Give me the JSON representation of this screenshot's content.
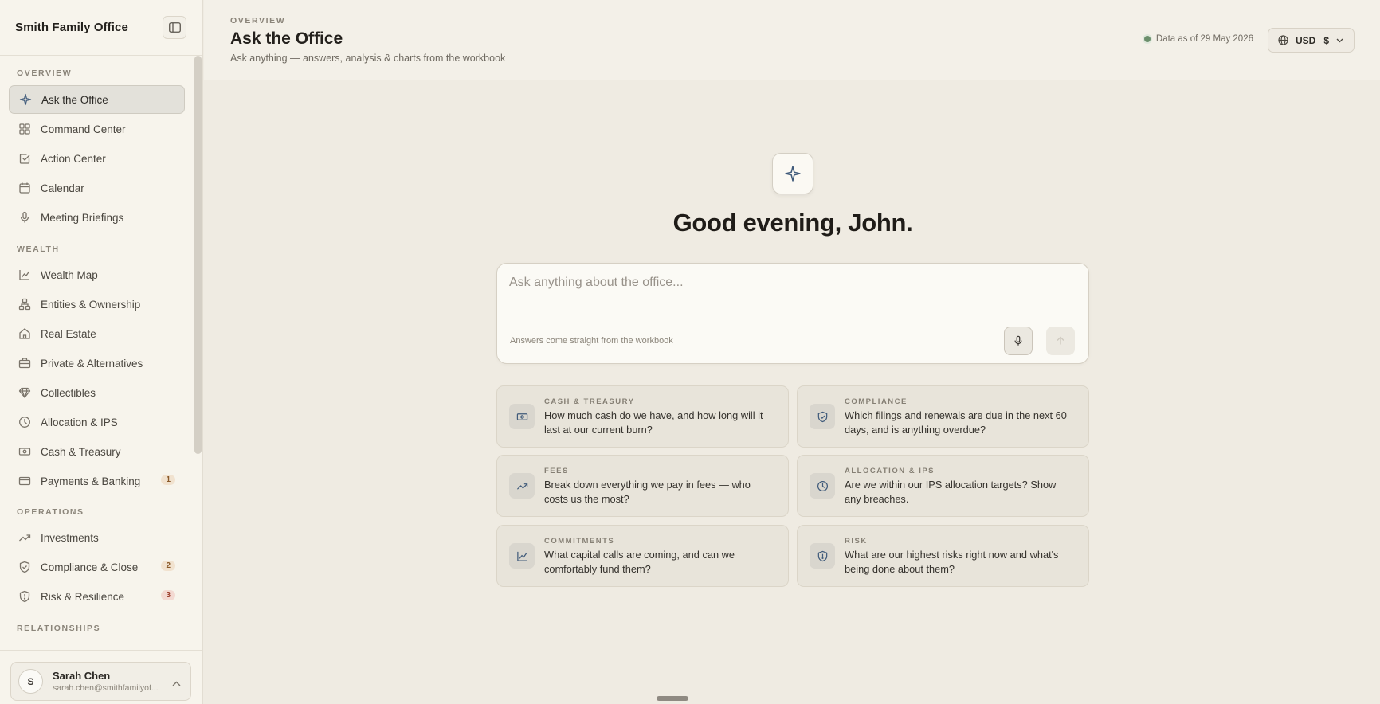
{
  "brand": "Smith Family Office",
  "sidebar": {
    "sections": [
      {
        "label": "OVERVIEW"
      },
      {
        "label": "WEALTH"
      },
      {
        "label": "OPERATIONS"
      },
      {
        "label": "RELATIONSHIPS"
      }
    ],
    "items": [
      {
        "label": "Ask the Office",
        "icon": "sparkle-icon",
        "active": true
      },
      {
        "label": "Command Center",
        "icon": "grid-icon"
      },
      {
        "label": "Action Center",
        "icon": "checkbox-icon"
      },
      {
        "label": "Calendar",
        "icon": "calendar-icon"
      },
      {
        "label": "Meeting Briefings",
        "icon": "mic-icon"
      },
      {
        "label": "Wealth Map",
        "icon": "line-chart-icon"
      },
      {
        "label": "Entities & Ownership",
        "icon": "org-chart-icon"
      },
      {
        "label": "Real Estate",
        "icon": "house-icon"
      },
      {
        "label": "Private & Alternatives",
        "icon": "briefcase-icon"
      },
      {
        "label": "Collectibles",
        "icon": "diamond-icon"
      },
      {
        "label": "Allocation & IPS",
        "icon": "clock-icon"
      },
      {
        "label": "Cash & Treasury",
        "icon": "banknote-icon"
      },
      {
        "label": "Payments & Banking",
        "icon": "card-icon",
        "badge": "1"
      },
      {
        "label": "Investments",
        "icon": "trend-up-icon"
      },
      {
        "label": "Compliance & Close",
        "icon": "shield-icon",
        "badge": "2"
      },
      {
        "label": "Risk & Resilience",
        "icon": "alert-shield-icon",
        "badge": "3"
      }
    ]
  },
  "user": {
    "initial": "S",
    "name": "Sarah Chen",
    "email": "sarah.chen@smithfamilyof..."
  },
  "header": {
    "crumb": "OVERVIEW",
    "title": "Ask the Office",
    "subtitle": "Ask anything — answers, analysis & charts from the workbook",
    "data_asof": "Data as of 29 May 2026",
    "currency": "USD",
    "currency_symbol": "$"
  },
  "main": {
    "greeting": "Good evening, John.",
    "ask_placeholder": "Ask anything about the office...",
    "ask_hint": "Answers come straight from the workbook"
  },
  "suggestions": [
    {
      "tag": "CASH & TREASURY",
      "text": "How much cash do we have, and how long will it last at our current burn?",
      "icon": "banknote-icon"
    },
    {
      "tag": "COMPLIANCE",
      "text": "Which filings and renewals are due in the next 60 days, and is anything overdue?",
      "icon": "shield-check-icon"
    },
    {
      "tag": "FEES",
      "text": "Break down everything we pay in fees — who costs us the most?",
      "icon": "trend-up-icon"
    },
    {
      "tag": "ALLOCATION & IPS",
      "text": "Are we within our IPS allocation targets? Show any breaches.",
      "icon": "clock-icon"
    },
    {
      "tag": "COMMITMENTS",
      "text": "What capital calls are coming, and can we comfortably fund them?",
      "icon": "line-chart-icon"
    },
    {
      "tag": "RISK",
      "text": "What are our highest risks right now and what's being done about them?",
      "icon": "alert-shield-icon"
    }
  ]
}
